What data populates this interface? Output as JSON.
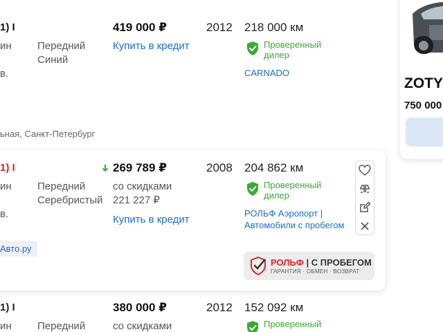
{
  "row1": {
    "title_fragment": "1) I",
    "engine_fragment": "ин",
    "tax_fragment": "в.",
    "drive": "Передний",
    "color": "Синий",
    "price": "419 000 ₽",
    "credit_link": "Купить в кредит",
    "year": "2012",
    "mileage": "218 000 км",
    "verified": [
      "Проверенный",
      "дилер"
    ],
    "dealer": "CARNADO",
    "location": "ьная, Санкт-Петербург"
  },
  "row2": {
    "title_fragment": "1) I",
    "engine_fragment": "ин",
    "tax_fragment": "в.",
    "drive": "Передний",
    "color": "Серебристый",
    "price": "269 789 ₽",
    "discount_label": "со скидками",
    "discount_price": "221 227 ₽",
    "credit_link": "Купить в кредит",
    "year": "2008",
    "mileage": "204 862 км",
    "verified": [
      "Проверенный",
      "дилер"
    ],
    "dealer_lines": [
      "РОЛЬФ Аэропорт |",
      "Автомобили с пробегом"
    ],
    "source_chip": "Авто.ру",
    "logo_text": {
      "main": "РОЛЬФ",
      "sub": "| С ПРОБЕГОМ",
      "tagline": "ГАРАНТИЯ · ОБМЕН · ВОЗВРАТ"
    },
    "price_trend": "down",
    "accent_green": "#3aaa35",
    "accent_red": "#e0201c"
  },
  "row3": {
    "title_fragment": "1) I",
    "engine_fragment": "ин",
    "drive": "Передний",
    "price": "380 000 ₽",
    "discount_label": "со скидками",
    "year": "2012",
    "mileage": "152 092 км",
    "verified": [
      "Проверенный"
    ]
  },
  "side": {
    "model_fragment": "ZOTY",
    "price_fragment": "750 000"
  },
  "icons": [
    "shield-check-icon",
    "heart-icon",
    "compare-icon",
    "note-icon",
    "close-icon",
    "arrow-down-icon"
  ]
}
